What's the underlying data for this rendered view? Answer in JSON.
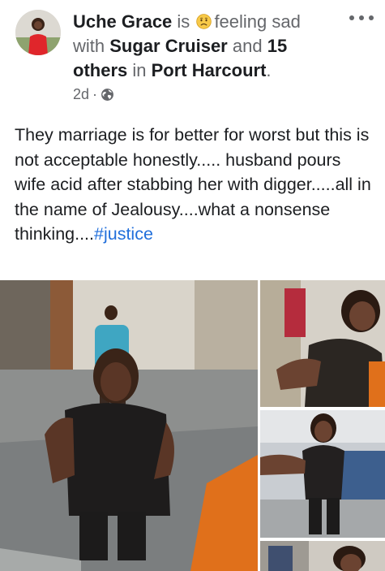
{
  "post": {
    "author": "Uche Grace",
    "is_word": "is",
    "feeling_icon": "sad-face-emoji",
    "feeling_text": "feeling sad",
    "with_word": "with",
    "tagged_person": "Sugar Cruiser",
    "and_word": "and",
    "others": "15 others",
    "in_word": "in",
    "location": "Port Harcourt",
    "period": ".",
    "time": "2d",
    "separator": "·",
    "privacy_icon": "globe-icon",
    "more_icon": "more-options-icon",
    "text": "They marriage is for better for worst but this is not acceptable honestly..... husband pours wife acid after stabbing her with digger.....all in the name of Jealousy....what a nonsense thinking....",
    "hashtag": "#justice"
  },
  "photos": [
    {
      "label": "photo-1"
    },
    {
      "label": "photo-2"
    },
    {
      "label": "photo-3"
    },
    {
      "label": "photo-4"
    }
  ],
  "colors": {
    "text": "#1c1e21",
    "secondary": "#65676b",
    "link": "#216fdb"
  }
}
